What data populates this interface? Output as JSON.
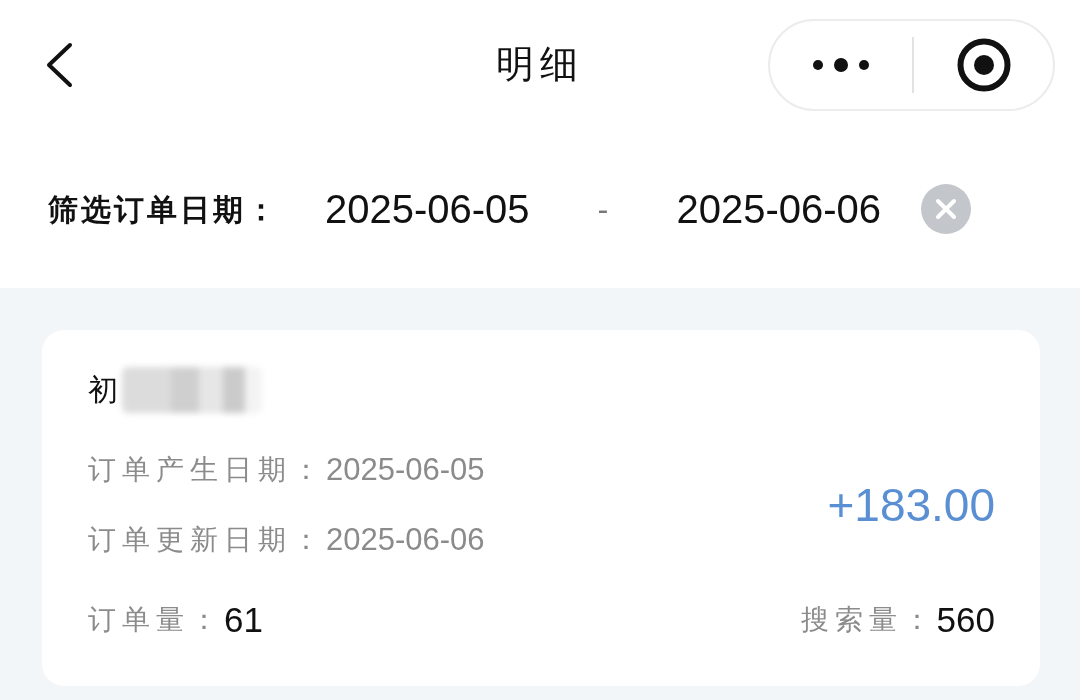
{
  "nav_bar": {
    "title": "明细"
  },
  "filter": {
    "label": "筛选订单日期：",
    "start_date": "2025-06-05",
    "separator": "-",
    "end_date": "2025-06-06"
  },
  "orders": [
    {
      "name": "初",
      "name_blurred": true,
      "created_label": "订单产生日期：",
      "created": "2025-06-05",
      "updated_label": "订单更新日期：",
      "updated": "2025-06-06",
      "amount": "+183.00",
      "order_count_label": "订单量：",
      "order_count": "61",
      "search_count_label": "搜索量：",
      "search_count": "560"
    }
  ]
}
